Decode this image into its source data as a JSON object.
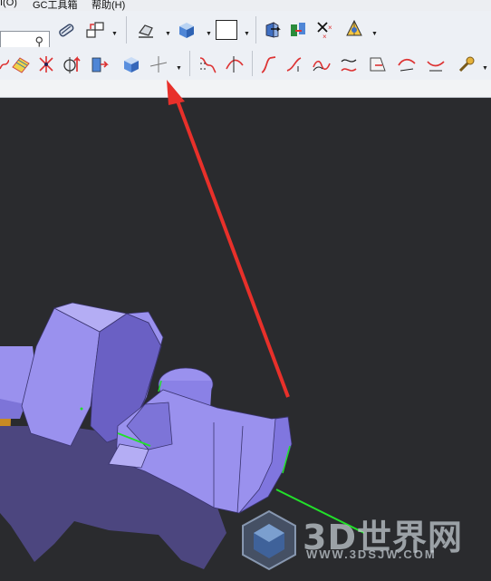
{
  "menubar": {
    "items": [
      "I(O)",
      "GC工具箱",
      "帮助(H)"
    ]
  },
  "toolbar_top": {
    "search_icon": "magnifier-icon",
    "icons": [
      "edit-link-icon",
      "copy-window-icon",
      "view-style-icon",
      "shaded-cube-icon",
      "background-color-icon",
      "cube-arrow-icon",
      "relations-icon",
      "delete-symbol-icon",
      "cone-highlight-icon"
    ]
  },
  "toolbar_mid": {
    "icons": [
      "spline-icon",
      "curve-grid-icon",
      "axis-star-icon",
      "extrude-arrow-icon",
      "sphere-icon",
      "cylinder-icon",
      "cube-icon",
      "point-icon",
      "surface-icon",
      "trim-curve-icon",
      "bridge-curve-icon",
      "offset-curve-icon",
      "silhouette-icon",
      "project-curve-icon",
      "face-curve-icon",
      "curve-approx-icon",
      "sweep-curve-icon",
      "wrench-icon"
    ]
  },
  "annotation": {
    "arrow_color": "#e8302a"
  },
  "colors": {
    "part": "#9a91ee",
    "part_shadow": "#6a60c4",
    "part_dark": "#4c467f",
    "axis": "#22e02a",
    "viewport_bg": "#2a2b2e"
  },
  "watermark": {
    "title": "3D世界网",
    "url": "WWW.3DSJW.COM"
  }
}
